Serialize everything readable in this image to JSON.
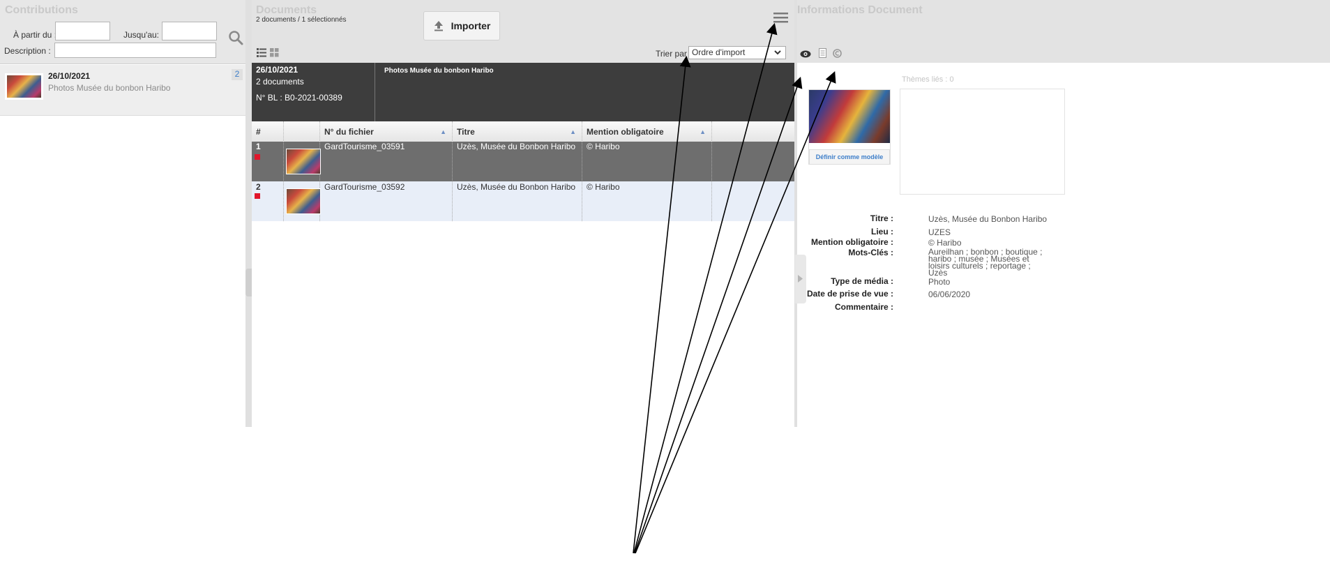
{
  "contributions": {
    "title": "Contributions",
    "from_label": "À partir du :",
    "to_label": "Jusqu'au:",
    "description_label": "Description :",
    "from_value": "",
    "to_value": "",
    "description_value": "",
    "item": {
      "date": "26/10/2021",
      "subtitle": "Photos Musée du bonbon Haribo",
      "count": "2"
    }
  },
  "documents": {
    "title": "Documents",
    "subtitle": "2 documents / 1 sélectionnés",
    "import_label": "Importer",
    "sort_label": "Trier par",
    "sort_value": "Ordre d'import",
    "summary": {
      "date": "26/10/2021",
      "count": "2 documents",
      "bl": "N° BL :  B0-2021-00389",
      "title": "Photos Musée du bonbon Haribo"
    },
    "columns": [
      "#",
      "N° du fichier",
      "Titre",
      "Mention obligatoire"
    ],
    "rows": [
      {
        "num": "1",
        "file": "GardTourisme_03591",
        "title": "Uzès, Musée du Bonbon Haribo",
        "mention": "© Haribo"
      },
      {
        "num": "2",
        "file": "GardTourisme_03592",
        "title": "Uzès, Musée du Bonbon Haribo",
        "mention": "© Haribo"
      }
    ]
  },
  "info": {
    "title": "Informations Document",
    "themes_label": "Thèmes liés : 0",
    "model_button": "Définir comme modèle",
    "fields": [
      {
        "key": "Titre :",
        "value": "Uzès, Musée du Bonbon Haribo"
      },
      {
        "key": "Lieu :",
        "value": "UZES"
      },
      {
        "key": "Mention obligatoire :",
        "value": "© Haribo"
      },
      {
        "key": "Mots-Clés :",
        "value": "Aureilhan ; bonbon ; boutique ; haribo ; musée ; Musées et loisirs culturels ; reportage ; Uzès"
      },
      {
        "key": "Type de média :",
        "value": "Photo"
      },
      {
        "key": "Date de prise de vue :",
        "value": "06/06/2020"
      },
      {
        "key": "Commentaire :",
        "value": ""
      }
    ]
  },
  "colors": {
    "selected_row": "#6e6e6e",
    "alt_row": "#e8eef8",
    "summary_bg": "#3d3d3d",
    "accent": "#e0162b"
  },
  "icons": [
    "search-icon",
    "menu-icon",
    "list-view-icon",
    "grid-view-icon",
    "upload-icon",
    "eye-icon",
    "document-icon",
    "copyright-icon",
    "sort-icon",
    "chevron-right-icon"
  ]
}
